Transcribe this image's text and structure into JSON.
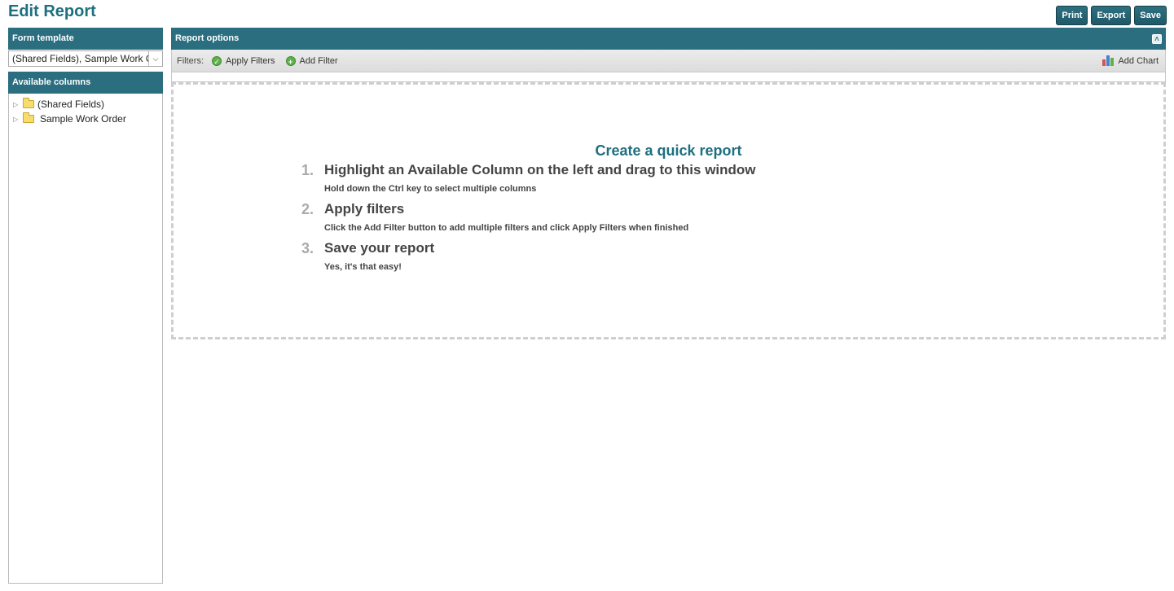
{
  "page_title": "Edit Report",
  "toolbar": {
    "print_label": "Print",
    "export_label": "Export",
    "save_label": "Save"
  },
  "form_template": {
    "header": "Form template",
    "selected_value": "(Shared Fields), Sample Work Order"
  },
  "available_columns": {
    "header": "Available columns",
    "items": [
      {
        "label": "(Shared Fields)",
        "icon": "folder-icon"
      },
      {
        "label": "Sample Work Order",
        "icon": "folder-icon"
      }
    ]
  },
  "report_options": {
    "header": "Report options",
    "filters_label": "Filters:",
    "apply_filters_label": "Apply Filters",
    "add_filter_label": "Add Filter",
    "add_chart_label": "Add Chart"
  },
  "quick_report": {
    "title": "Create a quick report",
    "steps": [
      {
        "number": "1.",
        "title": "Highlight an Available Column on the left and drag to this window",
        "desc": "Hold down the Ctrl key to select multiple columns"
      },
      {
        "number": "2.",
        "title": "Apply filters",
        "desc": "Click the Add Filter button to add multiple filters and click Apply Filters when finished"
      },
      {
        "number": "3.",
        "title": "Save your report",
        "desc": "Yes, it's that easy!"
      }
    ]
  },
  "colors": {
    "header_bg": "#2a6e80",
    "title_color": "#1e6f7f",
    "accent_green": "#5fb24a"
  }
}
